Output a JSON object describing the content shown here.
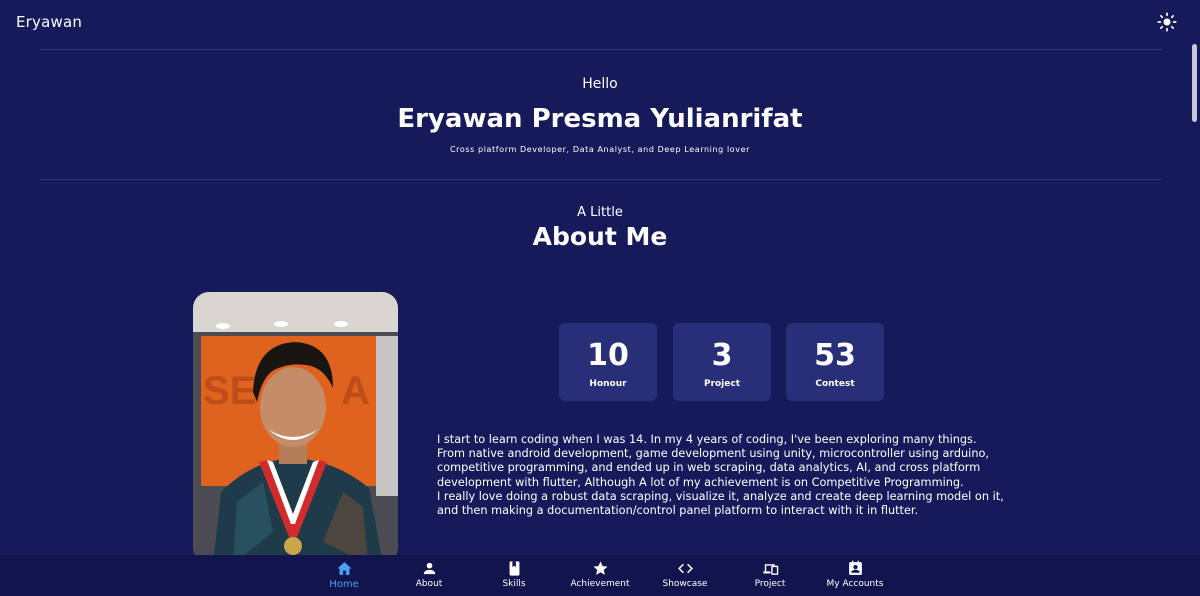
{
  "header": {
    "brand": "Eryawan",
    "theme_toggle_icon": "sun-icon"
  },
  "hero": {
    "greeting": "Hello",
    "name": "Eryawan Presma Yulianrifat",
    "tagline": "Cross platform Developer, Data Analyst, and Deep Learning lover"
  },
  "about": {
    "kicker": "A Little",
    "title": "About Me",
    "stats": [
      {
        "value": "10",
        "label": "Honour"
      },
      {
        "value": "3",
        "label": "Project"
      },
      {
        "value": "53",
        "label": "Contest"
      }
    ],
    "bio_lines": [
      "I start to learn coding when I was 14. In my 4 years of coding, I've been exploring many things.",
      "From native android development, game development using unity, microcontroller using arduino,",
      "competitive programming, and ended up in web scraping, data analytics, AI, and cross platform",
      "development with flutter, Although A lot of my achievement is on Competitive Programming.",
      "I really love doing a robust data scraping, visualize it, analyze and create deep learning model on it,",
      "and then making a documentation/control panel platform to interact with it in flutter."
    ]
  },
  "bottom_nav": {
    "items": [
      {
        "label": "Home",
        "icon": "home-icon",
        "active": true
      },
      {
        "label": "About",
        "icon": "person-icon",
        "active": false
      },
      {
        "label": "Skills",
        "icon": "book-icon",
        "active": false
      },
      {
        "label": "Achievement",
        "icon": "star-icon",
        "active": false
      },
      {
        "label": "Showcase",
        "icon": "code-icon",
        "active": false
      },
      {
        "label": "Project",
        "icon": "devices-icon",
        "active": false
      },
      {
        "label": "My Accounts",
        "icon": "contact-icon",
        "active": false
      }
    ]
  },
  "colors": {
    "background": "#161a5b",
    "card": "#282f78",
    "nav_background": "#11144d",
    "active_nav": "#49a1f3"
  }
}
